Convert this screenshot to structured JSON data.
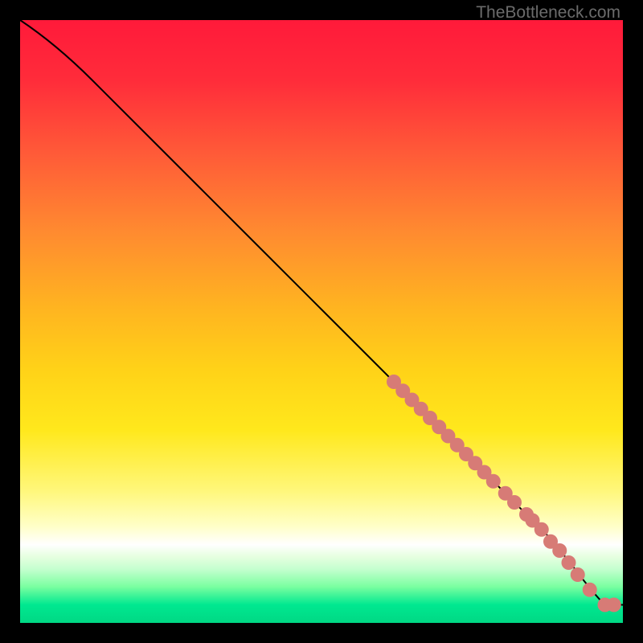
{
  "watermark": "TheBottleneck.com",
  "colors": {
    "dot": "#d77b76",
    "curve": "#000000",
    "background": "#000000"
  },
  "chart_data": {
    "type": "line",
    "title": "",
    "xlabel": "",
    "ylabel": "",
    "xlim": [
      0,
      100
    ],
    "ylim": [
      0,
      100
    ],
    "grid": false,
    "series": [
      {
        "name": "curve",
        "x": [
          0,
          6,
          12,
          20,
          30,
          40,
          50,
          60,
          70,
          80,
          88,
          92,
          95,
          97,
          100
        ],
        "y": [
          100,
          96,
          90,
          82,
          72,
          62,
          52,
          42,
          32,
          22,
          14,
          9,
          5,
          3,
          3
        ]
      },
      {
        "name": "points-cluster",
        "type": "scatter",
        "x": [
          62,
          63.5,
          65,
          66.5,
          68,
          69.5,
          71,
          72.5,
          74,
          75.5,
          77,
          78.5,
          80.5,
          82,
          84,
          85,
          86.5,
          88,
          89.5,
          91,
          92.5,
          94.5,
          97,
          98.5
        ],
        "y": [
          40,
          38.5,
          37,
          35.5,
          34,
          32.5,
          31,
          29.5,
          28,
          26.5,
          25,
          23.5,
          21.5,
          20,
          18,
          17,
          15.5,
          13.5,
          12,
          10,
          8,
          5.5,
          3,
          3
        ]
      }
    ]
  }
}
